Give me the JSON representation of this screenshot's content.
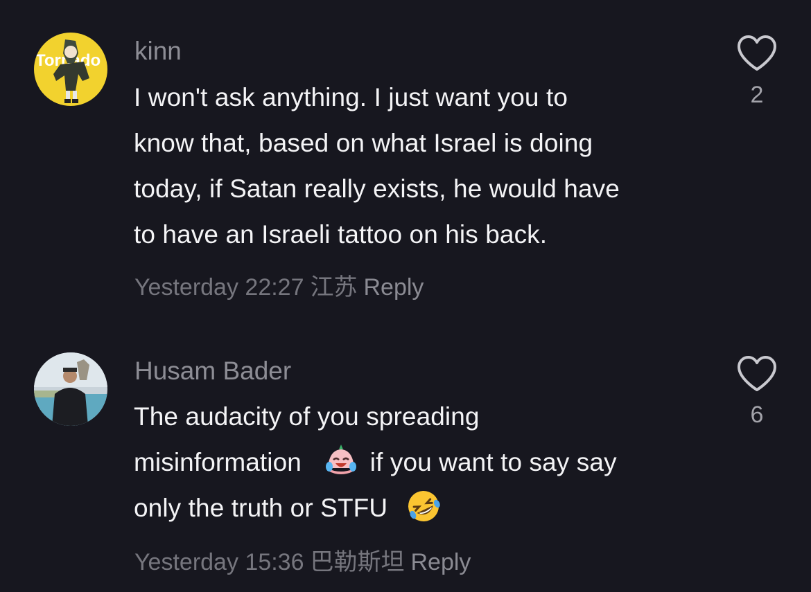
{
  "comments": [
    {
      "username": "kinn",
      "lines": [
        "I won't ask anything. I just want you to",
        "know that, based on what Israel is doing",
        "today, if Satan really exists, he would have",
        "to have an Israeli tattoo on his back."
      ],
      "time": "Yesterday 22:27",
      "location": "江苏",
      "reply_label": "Reply",
      "likes": "2",
      "avatar_text": "Tornado"
    },
    {
      "username": "Husam Bader",
      "line1": "The audacity of you spreading",
      "line2_before": "misinformation",
      "line2_after": "if you want to say say",
      "line3": "only the truth or STFU",
      "time": "Yesterday 15:36",
      "location": "巴勒斯坦",
      "reply_label": "Reply",
      "likes": "6"
    }
  ],
  "icons": {
    "like": "heart-outline-icon",
    "emoji1": "crying-laughing-face-emoji",
    "emoji2": "rolling-on-floor-laughing-emoji"
  },
  "colors": {
    "background": "#17171f",
    "text": "#f4f4f6",
    "muted": "#8d8d95"
  }
}
